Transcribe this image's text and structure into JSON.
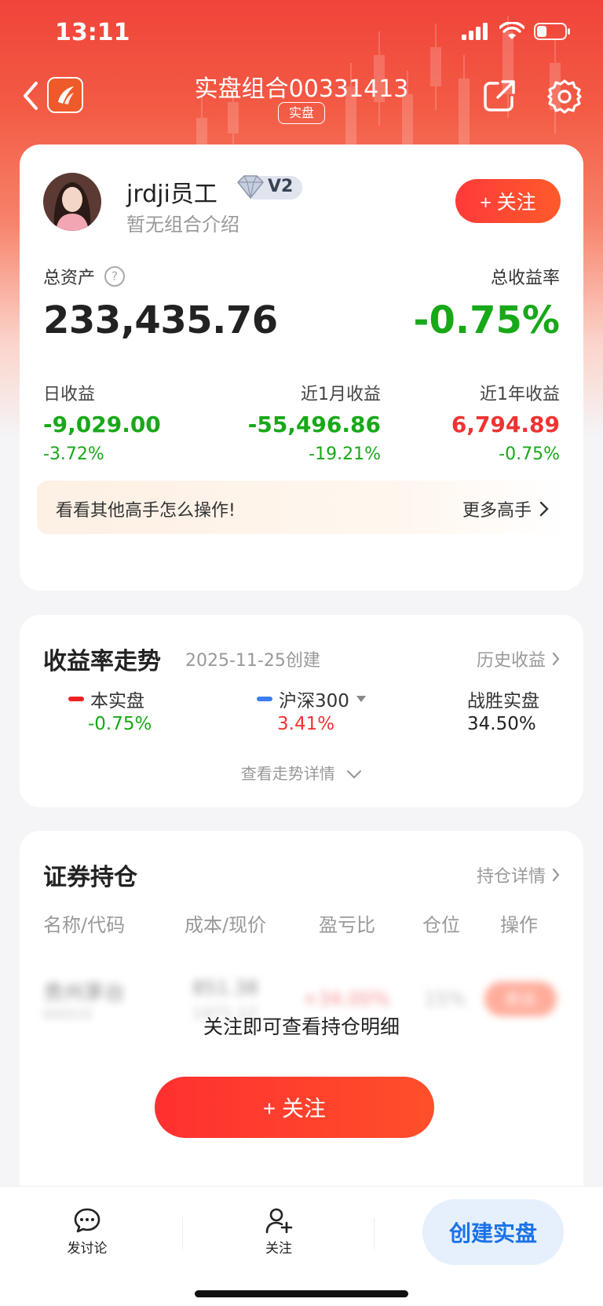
{
  "status_bar": {
    "time": "13:11",
    "icons": [
      "signal-icon",
      "wifi-icon",
      "battery-icon"
    ]
  },
  "nav": {
    "title": "实盘组合00331413",
    "badge": "实盘",
    "icons": [
      "back-icon",
      "app-logo-icon",
      "share-icon",
      "gear-icon"
    ]
  },
  "profile": {
    "username": "jrdji员工",
    "level": "V2",
    "intro": "暂无组合介绍",
    "follow_label": "+ 关注"
  },
  "summary": {
    "total_assets_label": "总资产",
    "help_symbol": "?",
    "total_assets_value": "233,435.76",
    "total_return_label": "总收益率",
    "total_return_value": "-0.75%",
    "stats": [
      {
        "label": "日收益",
        "value": "-9,029.00",
        "pct": "-3.72%",
        "color": "#18a818"
      },
      {
        "label": "近1月收益",
        "value": "-55,496.86",
        "pct": "-19.21%",
        "color": "#18a818"
      },
      {
        "label": "近1年收益",
        "value": "6,794.89",
        "pct": "-0.75%",
        "color": "#ee3333"
      }
    ]
  },
  "promo": {
    "text": "看看其他高手怎么操作!",
    "more": "更多高手"
  },
  "trend": {
    "title": "收益率走势",
    "created": "2025-11-25创建",
    "history_link": "历史收益",
    "legend": [
      {
        "label": "本实盘",
        "value": "-0.75%",
        "color": "#ee2222"
      },
      {
        "label": "沪深300",
        "value": "3.41%",
        "color": "#3a7ef0"
      },
      {
        "label": "战胜实盘",
        "value": "34.50%"
      }
    ],
    "details": "查看走势详情"
  },
  "holdings": {
    "title": "证券持仓",
    "detail_link": "持仓详情",
    "columns": [
      "名称/代码",
      "成本/现价",
      "盈亏比",
      "仓位",
      "操作"
    ],
    "blurred_row": {
      "name": "贵州茅台",
      "code": "600519",
      "cost": "851.38",
      "price": "1471.12",
      "pnl": "+34.00%",
      "position": "15%",
      "action": "卖出"
    },
    "lock_text": "关注即可查看持仓明细",
    "follow_label": "+ 关注"
  },
  "bottom_bar": {
    "discuss": "发讨论",
    "follow": "关注",
    "create": "创建实盘"
  },
  "colors": {
    "brand_red": "#f0443a",
    "up_red": "#ee3333",
    "down_green": "#18a818",
    "link_blue": "#1b72e8"
  }
}
